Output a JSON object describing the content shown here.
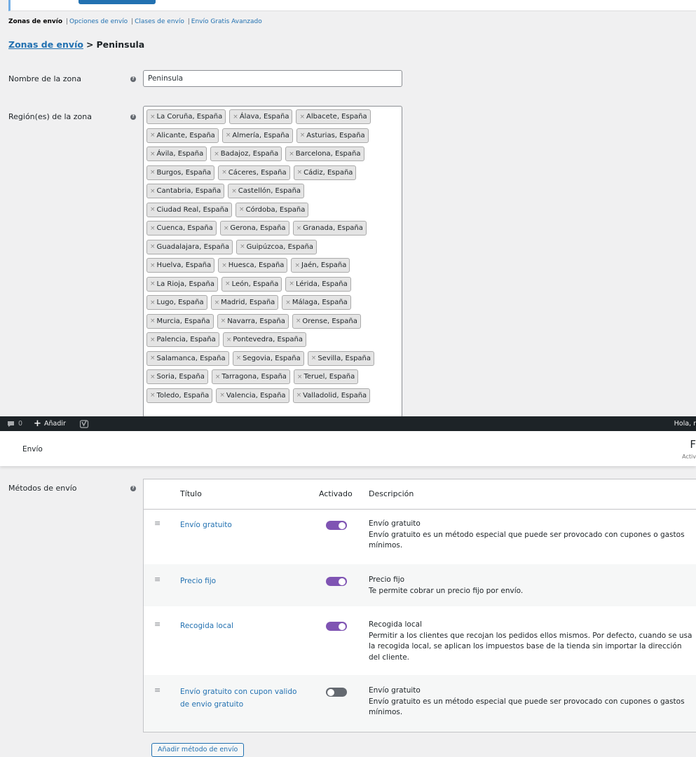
{
  "subnav": {
    "items": [
      "Zonas de envío",
      "Opciones de envío",
      "Clases de envío",
      "Envío Gratis Avanzado"
    ],
    "separator": "|"
  },
  "breadcrumb": {
    "link": "Zonas de envío",
    "separator": ">",
    "current": "Peninsula"
  },
  "zone_name": {
    "label": "Nombre de la zona",
    "value": "Peninsula",
    "help": "?"
  },
  "regions": {
    "label": "Región(es) de la zona",
    "help": "?",
    "remove_symbol": "×",
    "rows": [
      [
        "La Coruña, España",
        "Álava, España",
        "Albacete, España"
      ],
      [
        "Alicante, España",
        "Almería, España",
        "Asturias, España"
      ],
      [
        "Ávila, España",
        "Badajoz, España",
        "Barcelona, España"
      ],
      [
        "Burgos, España",
        "Cáceres, España",
        "Cádiz, España"
      ],
      [
        "Cantabria, España",
        "Castellón, España"
      ],
      [
        "Ciudad Real, España",
        "Córdoba, España"
      ],
      [
        "Cuenca, España",
        "Gerona, España",
        "Granada, España"
      ],
      [
        "Guadalajara, España",
        "Guipúzcoa, España"
      ],
      [
        "Huelva, España",
        "Huesca, España",
        "Jaén, España"
      ],
      [
        "La Rioja, España",
        "León, España",
        "Lérida, España"
      ],
      [
        "Lugo, España",
        "Madrid, España",
        "Málaga, España"
      ],
      [
        "Murcia, España",
        "Navarra, España",
        "Orense, España"
      ],
      [
        "Palencia, España",
        "Pontevedra, España"
      ],
      [
        "Salamanca, España",
        "Segovia, España",
        "Sevilla, España"
      ],
      [
        "Soria, España",
        "Tarragona, España",
        "Teruel, España"
      ],
      [
        "Toledo, España",
        "Valencia, España",
        "Valladolid, España"
      ]
    ]
  },
  "admin_bar": {
    "comments_count": "0",
    "new_label": "Añadir",
    "greeting": "Hola, r"
  },
  "header": {
    "title": "Envío",
    "right_text": "F",
    "right_subtext": "Activ"
  },
  "methods": {
    "label": "Métodos de envío",
    "help": "?",
    "columns": {
      "title": "Título",
      "enabled": "Activado",
      "description": "Descripción"
    },
    "handle": "≡",
    "rows": [
      {
        "title": "Envío gratuito",
        "enabled": true,
        "desc_title": "Envío gratuito",
        "desc_text": "Envío gratuito es un método especial que puede ser provocado con cupones o gastos mínimos."
      },
      {
        "title": "Precio fijo",
        "enabled": true,
        "desc_title": "Precio fijo",
        "desc_text": "Te permite cobrar un precio fijo por envío."
      },
      {
        "title": "Recogida local",
        "enabled": true,
        "desc_title": "Recogida local",
        "desc_text": "Permitir a los clientes que recojan los pedidos ellos mismos. Por defecto, cuando se usa la recogida local, se aplican los impuestos base de la tienda sin importar la dirección del cliente."
      },
      {
        "title": "Envío gratuito con cupon valido de envio gratuito",
        "enabled": false,
        "desc_title": "Envío gratuito",
        "desc_text": "Envío gratuito es un método especial que puede ser provocado con cupones o gastos mínimos."
      }
    ],
    "add_button": "Añadir método de envío"
  },
  "colors": {
    "link": "#2271b1",
    "toggle_on": "#7f54b3",
    "toggle_off": "#646970",
    "admin_bar": "#1d2327"
  }
}
